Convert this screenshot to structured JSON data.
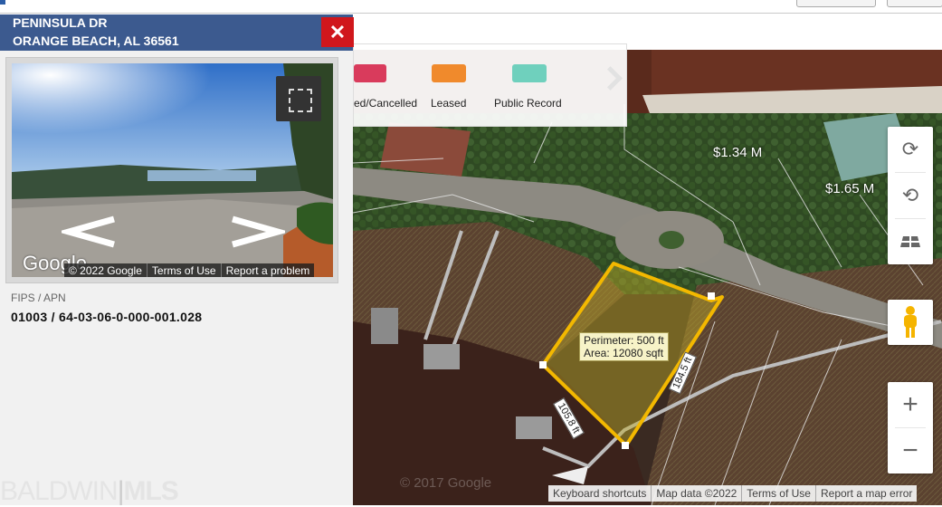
{
  "panel": {
    "address_line1": "PENINSULA DR",
    "address_line2": "ORANGE BEACH, AL 36561",
    "close_label": "✕",
    "street_view": {
      "attribution": [
        "© 2022 Google",
        "Terms of Use",
        "Report a problem"
      ],
      "google_logo": "Google"
    },
    "fips_label": "FIPS / APN",
    "fips_value": "01003 / 64-03-06-0-000-001.028",
    "brand_left": "BALDWIN",
    "brand_right": "MLS"
  },
  "legend": {
    "items": [
      {
        "label": "ed/Cancelled",
        "color": "#d93b5c"
      },
      {
        "label": "Leased",
        "color": "#f08a2c"
      },
      {
        "label": "Public Record",
        "color": "#6fd0bd"
      }
    ],
    "next_icon": "chevron-right-icon"
  },
  "map": {
    "price_labels": [
      "$1.34 M",
      "$1.65 M"
    ],
    "measurement": {
      "perimeter": "Perimeter: 500 ft",
      "area": "Area: 12080 sqft"
    },
    "dimensions": [
      "105.8 ft",
      "184.5 ft"
    ],
    "watermark": "© 2017 Google",
    "controls": {
      "rotate_cw_icon": "rotate-clockwise-icon",
      "rotate_ccw_icon": "rotate-counterclockwise-icon",
      "tilt_icon": "tilt-icon",
      "pegman_icon": "pegman-icon",
      "zoom_in": "+",
      "zoom_out": "−"
    },
    "attribution": [
      "Keyboard shortcuts",
      "Map data ©2022",
      "Terms of Use",
      "Report a map error"
    ]
  }
}
